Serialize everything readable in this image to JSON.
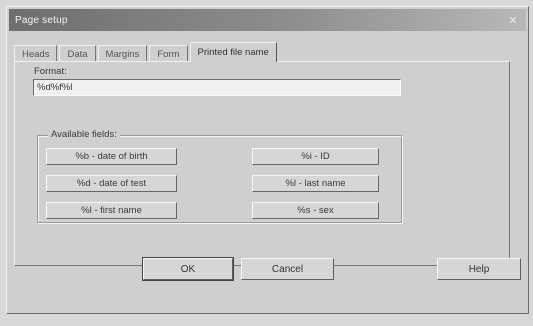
{
  "window": {
    "title": "Page setup",
    "close_glyph": "✕"
  },
  "tabs": [
    {
      "label": "Heads",
      "active": false
    },
    {
      "label": "Data",
      "active": false
    },
    {
      "label": "Margins",
      "active": false
    },
    {
      "label": "Form",
      "active": false
    },
    {
      "label": "Printed file name",
      "active": true
    }
  ],
  "format": {
    "label": "Format:",
    "value": "%d%f%l"
  },
  "available_fields": {
    "label": "Available fields:",
    "buttons": [
      "%b - date of birth",
      "%d - date of test",
      "%l - first name",
      "%i - ID",
      "%l - last name",
      "%s - sex"
    ]
  },
  "dialog_buttons": {
    "ok": "OK",
    "cancel": "Cancel",
    "help": "Help"
  }
}
